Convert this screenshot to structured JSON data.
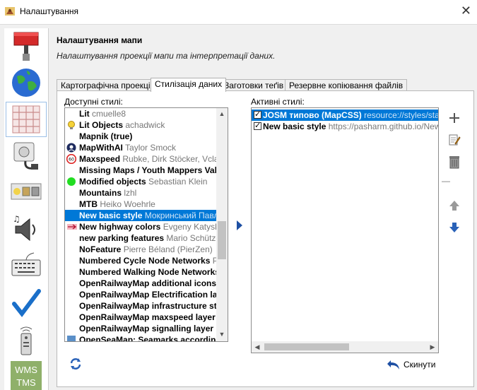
{
  "window": {
    "title": "Налаштування"
  },
  "sidebar": {
    "items": [
      {
        "name": "sidebar-item-display",
        "icon": "paint-roller-icon"
      },
      {
        "name": "sidebar-item-connection",
        "icon": "globe-icon"
      },
      {
        "name": "sidebar-item-map",
        "icon": "map-grid-icon"
      },
      {
        "name": "sidebar-item-plugins",
        "icon": "plug-icon"
      },
      {
        "name": "sidebar-item-presets",
        "icon": "toolbar-icon"
      },
      {
        "name": "sidebar-item-audio",
        "icon": "speaker-icon"
      },
      {
        "name": "sidebar-item-shortcuts",
        "icon": "keyboard-icon"
      },
      {
        "name": "sidebar-item-validator",
        "icon": "checkmark-icon"
      },
      {
        "name": "sidebar-item-remote",
        "icon": "remote-control-icon"
      },
      {
        "name": "sidebar-item-imagery",
        "icon": "wms-tms-icon",
        "text1": "WMS",
        "text2": "TMS"
      }
    ]
  },
  "header": {
    "title": "Налаштування мапи",
    "subtitle": "Налаштування проекції мапи та інтерпретації даних."
  },
  "tabs": [
    {
      "label": "Картографічна проекція"
    },
    {
      "label": "Стилізація даних"
    },
    {
      "label": "Заготовки теґів"
    },
    {
      "label": "Резервне копіювання файлів"
    }
  ],
  "available": {
    "label": "Доступні стилі:",
    "items": [
      {
        "name": "Lit",
        "author": "cmuelle8",
        "icon": ""
      },
      {
        "name": "Lit Objects",
        "author": "achadwick",
        "icon": "bulb-icon"
      },
      {
        "name": "Mapnik (true)",
        "author": "",
        "icon": ""
      },
      {
        "name": "MapWithAI",
        "author": "Taylor Smock",
        "icon": "mapwithai-icon"
      },
      {
        "name": "Maxspeed",
        "author": "Rubke, Dirk Stöcker, Vclaw,",
        "icon": "maxspeed-sign-icon",
        "sign": "60"
      },
      {
        "name": "Missing Maps / Youth Mappers Val",
        "author": "",
        "icon": ""
      },
      {
        "name": "Modified objects",
        "author": "Sebastian Klein",
        "icon": "green-dot-icon"
      },
      {
        "name": "Mountains",
        "author": "lzhl",
        "icon": ""
      },
      {
        "name": "MTB",
        "author": "Heiko Woehrle",
        "icon": ""
      },
      {
        "name": "New basic style",
        "author": "Мокринський Павло",
        "icon": "",
        "selected": true
      },
      {
        "name": "New highway colors",
        "author": "Evgeny Katyshev",
        "icon": "arrow-line-icon"
      },
      {
        "name": "new parking features",
        "author": "Mario Schütze",
        "icon": ""
      },
      {
        "name": "NoFeature",
        "author": "Pierre Béland (PierZen)",
        "icon": ""
      },
      {
        "name": "Numbered Cycle Node Networks",
        "author": "Po",
        "icon": ""
      },
      {
        "name": "Numbered Walking Node Networks",
        "author": "",
        "icon": ""
      },
      {
        "name": "OpenRailwayMap additional icons",
        "author": "",
        "icon": ""
      },
      {
        "name": "OpenRailwayMap Electrification lay",
        "author": "",
        "icon": ""
      },
      {
        "name": "OpenRailwayMap infrastructure st",
        "author": "",
        "icon": ""
      },
      {
        "name": "OpenRailwayMap maxspeed layer",
        "author": "",
        "icon": ""
      },
      {
        "name": "OpenRailwayMap signalling layer r",
        "author": "",
        "icon": ""
      },
      {
        "name": "OpenSeaMap: Seamarks according",
        "author": "",
        "icon": "sea-icon"
      }
    ]
  },
  "active": {
    "label": "Активні стилі:",
    "items": [
      {
        "name": "JOSM типово (MapCSS)",
        "source": "resource://styles/standard",
        "selected": true
      },
      {
        "name": "New basic style",
        "source": "https://pasharm.github.io/New_b"
      }
    ]
  },
  "buttons": {
    "reset_label": "Скинути",
    "separator": "—"
  },
  "colors": {
    "selection": "#0078d7",
    "arrow_blue": "#1d4fa3",
    "plus_green": "#555555"
  }
}
